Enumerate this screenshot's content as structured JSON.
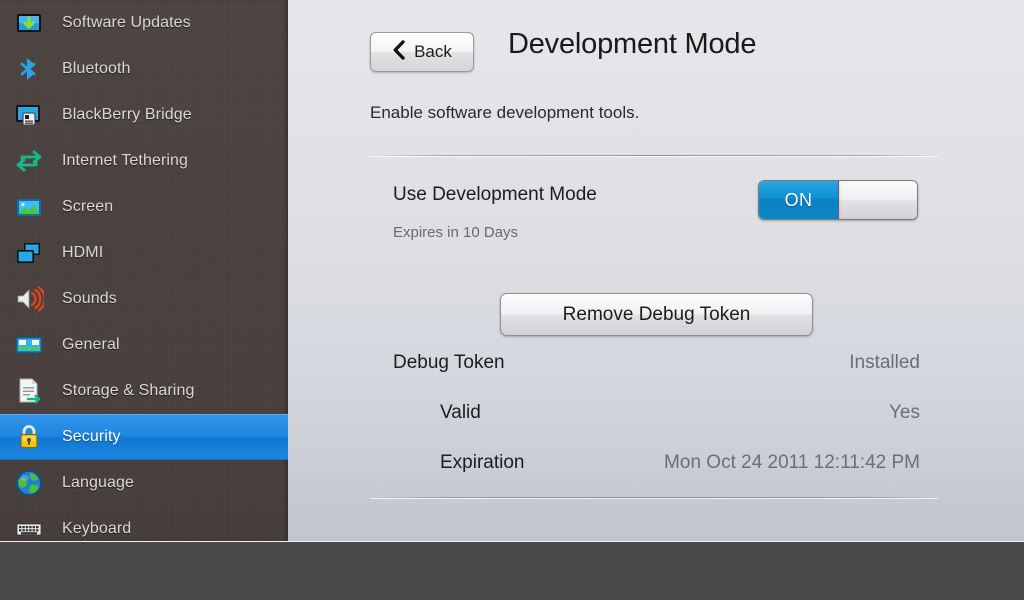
{
  "sidebar": {
    "items": [
      {
        "label": "Software Updates",
        "icon": "software-updates-icon",
        "selected": false
      },
      {
        "label": "Bluetooth",
        "icon": "bluetooth-icon",
        "selected": false
      },
      {
        "label": "BlackBerry Bridge",
        "icon": "blackberry-bridge-icon",
        "selected": false
      },
      {
        "label": "Internet Tethering",
        "icon": "internet-tethering-icon",
        "selected": false
      },
      {
        "label": "Screen",
        "icon": "screen-icon",
        "selected": false
      },
      {
        "label": "HDMI",
        "icon": "hdmi-icon",
        "selected": false
      },
      {
        "label": "Sounds",
        "icon": "sounds-icon",
        "selected": false
      },
      {
        "label": "General",
        "icon": "general-icon",
        "selected": false
      },
      {
        "label": "Storage & Sharing",
        "icon": "storage-sharing-icon",
        "selected": false
      },
      {
        "label": "Security",
        "icon": "lock-icon",
        "selected": true
      },
      {
        "label": "Language",
        "icon": "globe-icon",
        "selected": false
      },
      {
        "label": "Keyboard",
        "icon": "keyboard-icon",
        "selected": false
      }
    ]
  },
  "header": {
    "back_label": "Back",
    "back_icon": "chevron-left-icon",
    "title": "Development Mode"
  },
  "main": {
    "subtitle": "Enable software development tools.",
    "dev_mode": {
      "label": "Use Development Mode",
      "toggle_state": "ON",
      "expires_note": "Expires in 10 Days"
    },
    "remove_token_label": "Remove Debug Token",
    "details": [
      {
        "key": "Debug Token",
        "value": "Installed",
        "indent": 0
      },
      {
        "key": "Valid",
        "value": "Yes",
        "indent": 1
      },
      {
        "key": "Expiration",
        "value": "Mon Oct 24 2011 12:11:42 PM",
        "indent": 1
      }
    ]
  },
  "colors": {
    "accent_blue": "#1f85e0",
    "toggle_blue": "#108fd2",
    "sidebar_bg": "#4b4240",
    "panel_top": "#e6e7ea",
    "panel_bottom": "#c2c5ce",
    "chrome_bar": "#4a4a4a"
  }
}
